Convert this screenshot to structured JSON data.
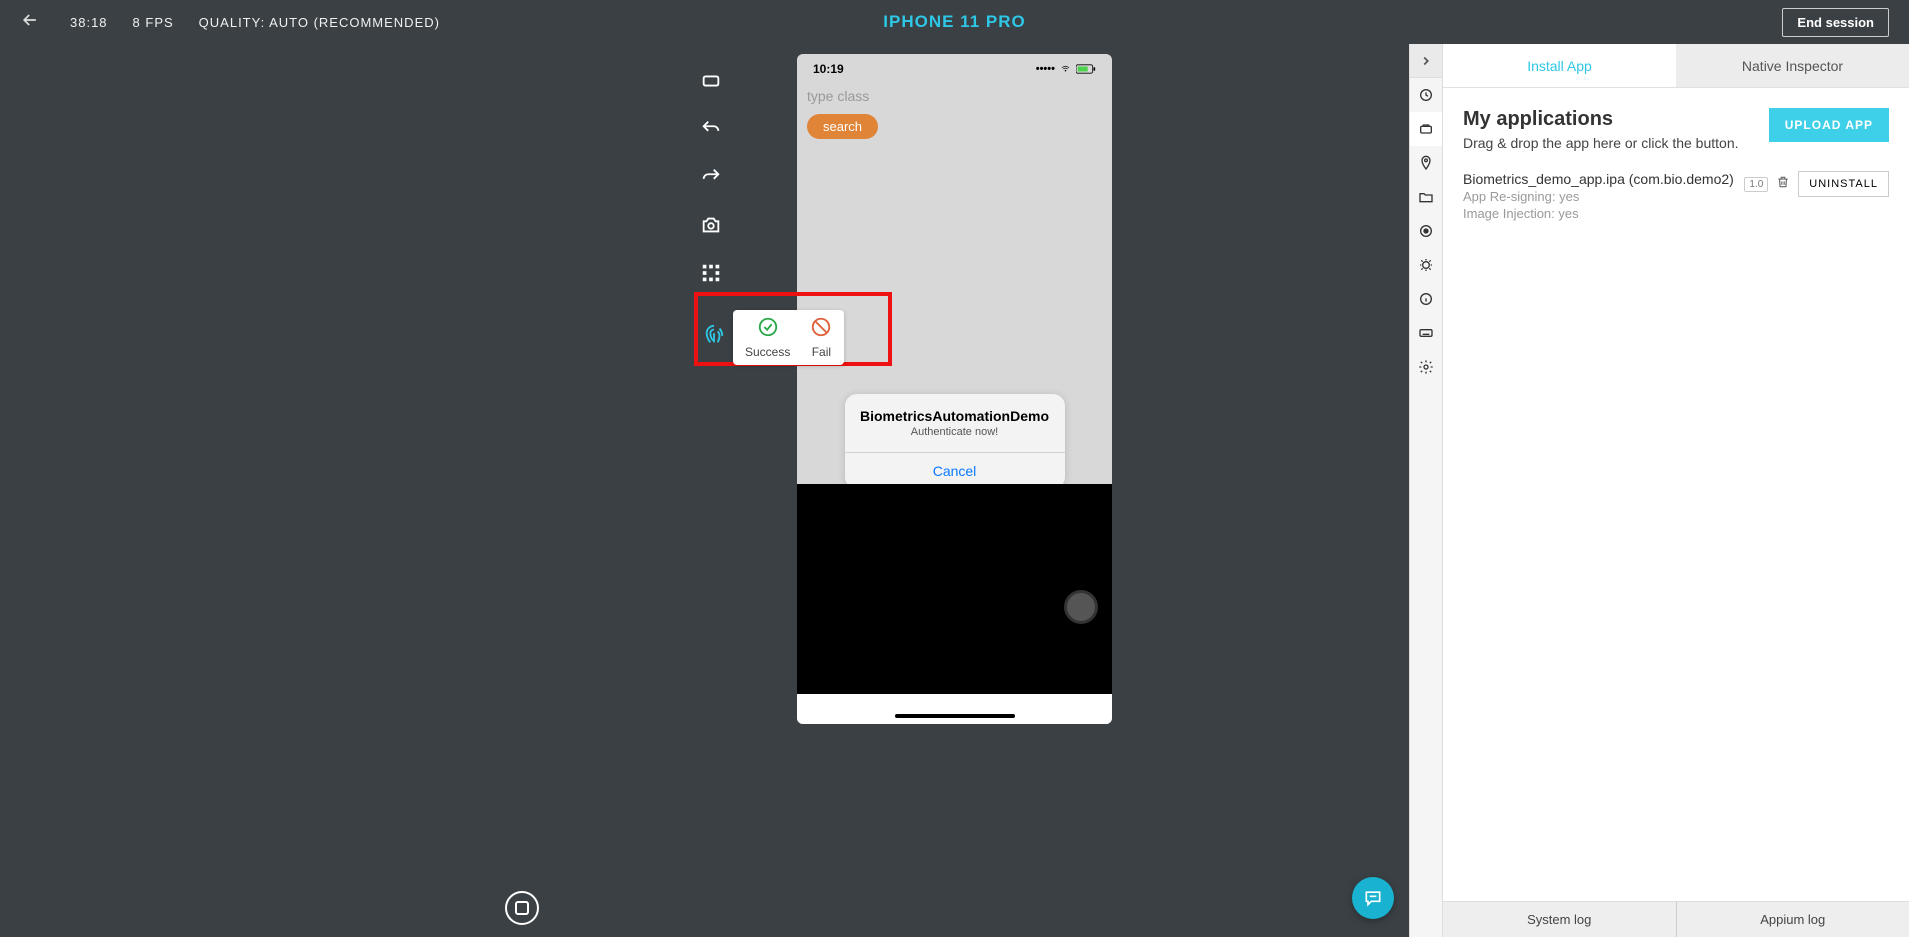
{
  "topbar": {
    "timer": "38:18",
    "fps": "8 FPS",
    "quality": "QUALITY: AUTO (RECOMMENDED)",
    "device": "IPHONE 11 PRO",
    "end_session": "End session"
  },
  "device": {
    "clock": "10:19",
    "placeholder": "type class",
    "search": "search",
    "alert_title": "BiometricsAutomationDemo",
    "alert_msg": "Authenticate now!",
    "alert_cancel": "Cancel"
  },
  "biometric": {
    "success": "Success",
    "fail": "Fail"
  },
  "panel": {
    "tab_install": "Install App",
    "tab_inspector": "Native Inspector",
    "apps_title": "My applications",
    "apps_sub": "Drag & drop the app here or click the button.",
    "upload": "UPLOAD APP",
    "app_name": "Biometrics_demo_app.ipa (com.bio.demo2)",
    "app_resign": "App Re-signing: yes",
    "app_inject": "Image Injection: yes",
    "version": "1.0",
    "uninstall": "UNINSTALL",
    "system_log": "System log",
    "appium_log": "Appium log"
  }
}
